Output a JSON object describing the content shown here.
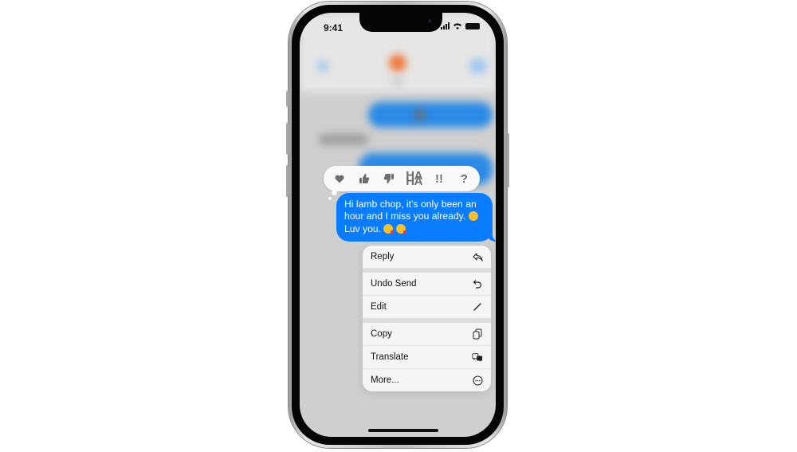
{
  "status_bar": {
    "time": "9:41"
  },
  "tapbacks": [
    {
      "name": "heart",
      "glyph": "♥"
    },
    {
      "name": "thumbs-up",
      "glyph": "👍"
    },
    {
      "name": "thumbs-down",
      "glyph": "👎"
    },
    {
      "name": "haha",
      "glyph": "HA HA"
    },
    {
      "name": "emphasize",
      "glyph": "!!"
    },
    {
      "name": "question",
      "glyph": "?"
    }
  ],
  "message": {
    "text_line1": "Hi lamb chop, it’s only been an hour and I miss you already. ",
    "text_line2": "Luv you. "
  },
  "context_menu": {
    "items": [
      {
        "label": "Reply",
        "icon": "reply-icon"
      },
      {
        "label": "Undo Send",
        "icon": "undo-icon"
      },
      {
        "label": "Edit",
        "icon": "pencil-icon"
      },
      {
        "label": "Copy",
        "icon": "copy-icon"
      },
      {
        "label": "Translate",
        "icon": "translate-icon"
      },
      {
        "label": "More...",
        "icon": "ellipsis-circle-icon"
      }
    ]
  },
  "colors": {
    "bubble_blue": "#0a7cff",
    "tapback_gray": "#6d6d70"
  }
}
